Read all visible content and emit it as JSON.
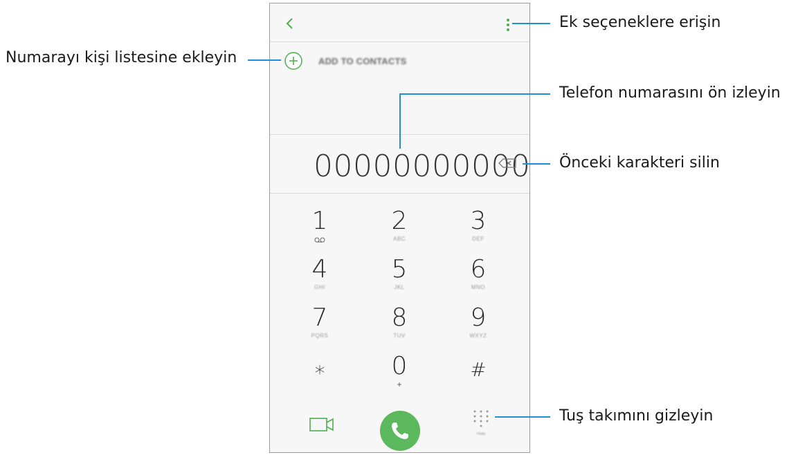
{
  "dialer": {
    "add_to_contacts_label": "ADD TO CONTACTS",
    "number": "00000000000",
    "keys": [
      {
        "digit": "1",
        "letters": "",
        "sub": "voicemail"
      },
      {
        "digit": "2",
        "letters": "ABC"
      },
      {
        "digit": "3",
        "letters": "DEF"
      },
      {
        "digit": "4",
        "letters": "GHI"
      },
      {
        "digit": "5",
        "letters": "JKL"
      },
      {
        "digit": "6",
        "letters": "MNO"
      },
      {
        "digit": "7",
        "letters": "PQRS"
      },
      {
        "digit": "8",
        "letters": "TUV"
      },
      {
        "digit": "9",
        "letters": "WXYZ"
      },
      {
        "digit": "∗",
        "letters": ""
      },
      {
        "digit": "0",
        "letters": "+"
      },
      {
        "digit": "#",
        "letters": ""
      }
    ],
    "hide_label": "Hide",
    "accent_color": "#5cb85c"
  },
  "callouts": {
    "more_options": "Ek seçeneklere erişin",
    "add_to_contacts": "Numarayı kişi listesine ekleyin",
    "preview_number": "Telefon numarasını ön izleyin",
    "delete_char": "Önceki karakteri silin",
    "hide_keypad": "Tuş takımını gizleyin",
    "line_color": "#1f8fd6"
  },
  "icons": [
    "back-icon",
    "more-options-icon",
    "add-contact-icon",
    "backspace-icon",
    "voicemail-icon",
    "video-call-icon",
    "phone-icon",
    "keypad-hide-icon"
  ]
}
